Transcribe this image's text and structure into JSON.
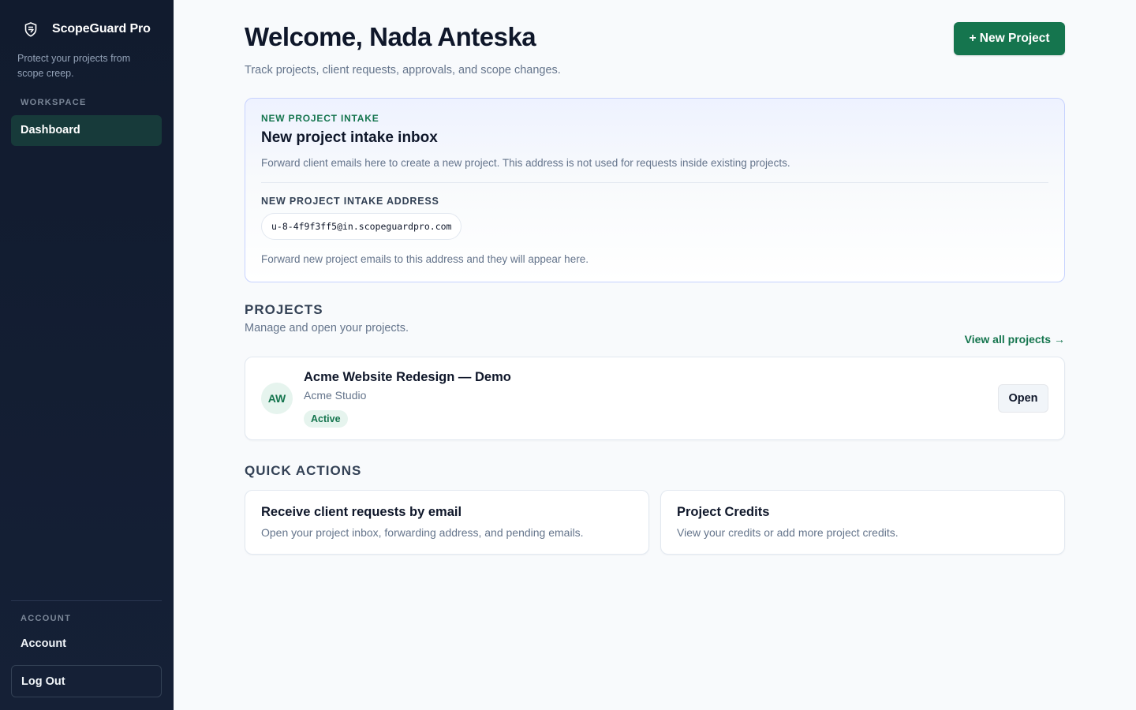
{
  "sidebar": {
    "brand_icon": "shield-icon",
    "brand_name": "ScopeGuard Pro",
    "tagline": "Protect your projects from scope creep.",
    "workspace_label": "WORKSPACE",
    "nav_items": [
      {
        "label": "Dashboard",
        "active": true
      }
    ],
    "account_label": "ACCOUNT",
    "account_link": "Account",
    "logout_label": "Log Out"
  },
  "header": {
    "title": "Welcome, Nada Anteska",
    "subtitle": "Track projects, client requests, approvals, and scope changes.",
    "new_project_label": "+ New Project"
  },
  "intake": {
    "eyebrow": "NEW PROJECT INTAKE",
    "title": "New project intake inbox",
    "description": "Forward client emails here to create a new project. This address is not used for requests inside existing projects.",
    "address_label": "NEW PROJECT INTAKE ADDRESS",
    "address": "u-8-4f9f3ff5@in.scopeguardpro.com",
    "help": "Forward new project emails to this address and they will appear here."
  },
  "projects": {
    "heading": "PROJECTS",
    "subtitle": "Manage and open your projects.",
    "view_all": "View all projects →",
    "items": [
      {
        "initials": "AW",
        "name": "Acme Website Redesign — Demo",
        "client": "Acme Studio",
        "status": "Active",
        "open_label": "Open"
      }
    ]
  },
  "quick_actions": {
    "heading": "QUICK ACTIONS",
    "items": [
      {
        "title": "Receive client requests by email",
        "description": "Open your project inbox, forwarding address, and pending emails."
      },
      {
        "title": "Project Credits",
        "description": "View your credits or add more project credits."
      }
    ]
  },
  "colors": {
    "sidebar_bg": "#111b2e",
    "accent": "#15754e",
    "active_nav_bg": "#173a3a"
  }
}
